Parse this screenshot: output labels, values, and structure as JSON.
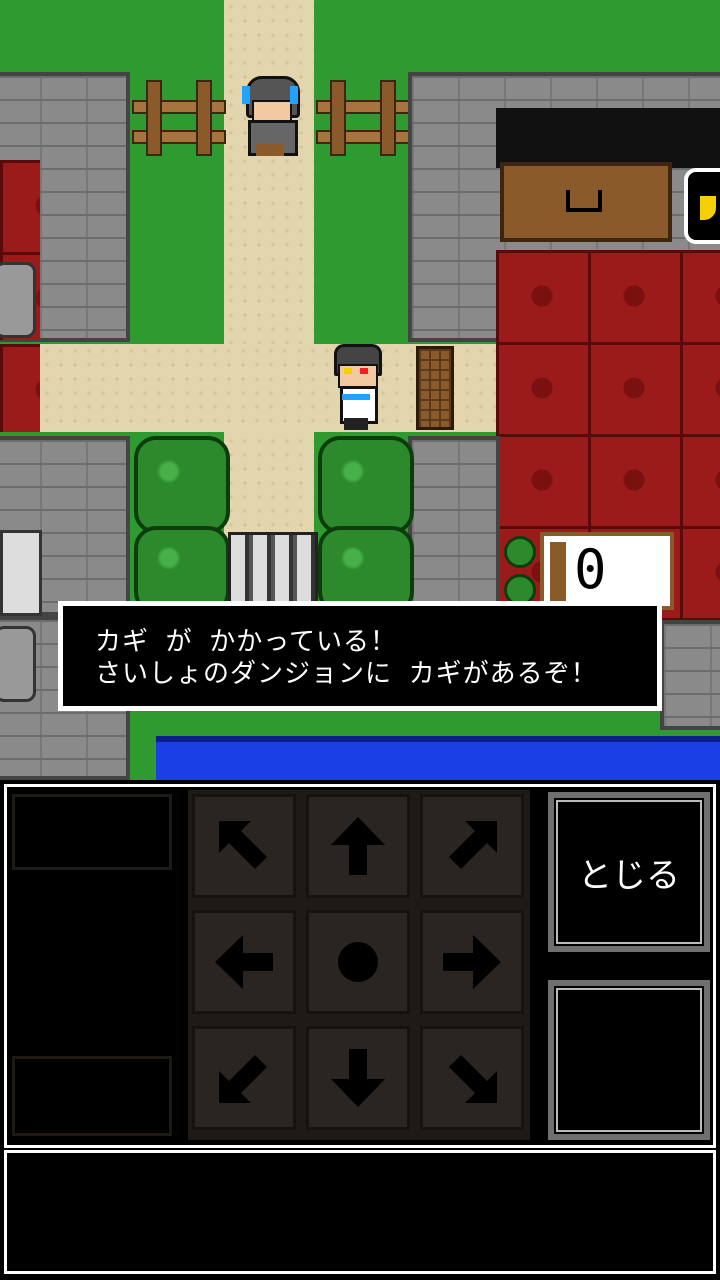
{
  "dialog": {
    "line1": "カギ が かかっている！",
    "line2": "さいしょのダンジョンに カギがあるぞ！"
  },
  "counter": {
    "value": "0"
  },
  "controls": {
    "close_label": "とじる",
    "dpad": [
      "arrow-up-left",
      "arrow-up",
      "arrow-up-right",
      "arrow-left",
      "center-dot",
      "arrow-right",
      "arrow-down-left",
      "arrow-down",
      "arrow-down-right"
    ]
  },
  "colors": {
    "grass": "#33a233",
    "path": "#e3d6ae",
    "wall": "#8a8a8a",
    "carpet": "#9b1a1a",
    "water": "#1a3fe6"
  }
}
